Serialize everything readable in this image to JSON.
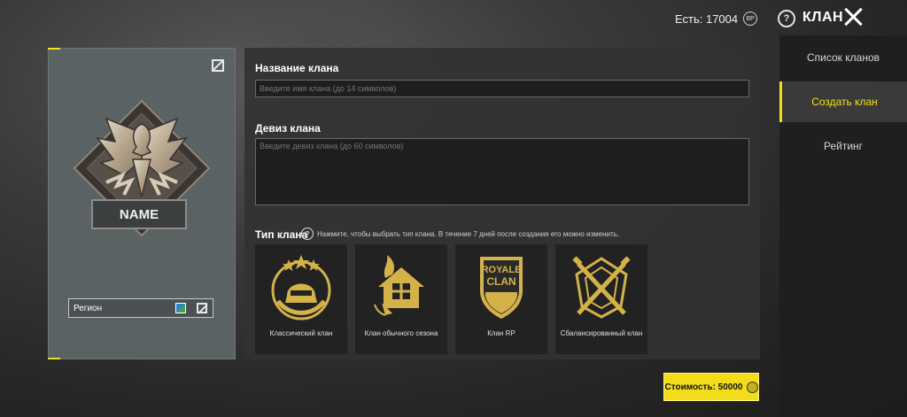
{
  "topbar": {
    "balance_label": "Есть: 17004",
    "coin_symbol": "BP",
    "help_symbol": "?",
    "title": "КЛАН"
  },
  "card": {
    "emblem_name": "NAME",
    "region_label": "Регион"
  },
  "form": {
    "name_label": "Название клана",
    "name_placeholder": "Введите имя клана (до 14 символов)",
    "motto_label": "Девиз клана",
    "motto_placeholder": "Введите девиз клана (до 60 символов)",
    "type_label": "Тип клана",
    "type_help_symbol": "?",
    "type_hint": "Нажмите, чтобы выбрать тип клана. В течение 7 дней после создания его можно изменить.",
    "types": [
      {
        "label": "Классический клан",
        "icon": "helmet-stars-icon"
      },
      {
        "label": "Клан обычного сезона",
        "icon": "house-flame-icon"
      },
      {
        "label": "Клан RP",
        "icon": "royale-clan-shield-icon",
        "badge_line1": "ROYALE",
        "badge_line2": "CLAN"
      },
      {
        "label": "Сбалансированный клан",
        "icon": "crossed-rifles-icon"
      }
    ]
  },
  "cost": {
    "label": "Стоимость: 50000"
  },
  "nav": {
    "items": [
      {
        "label": "Список кланов",
        "active": false
      },
      {
        "label": "Создать клан",
        "active": true
      },
      {
        "label": "Рейтинг",
        "active": false
      }
    ]
  },
  "colors": {
    "accent": "#f4e01a",
    "gold": "#d4b24a",
    "card_bg": "#5a6264",
    "panel_bg": "#323232"
  }
}
